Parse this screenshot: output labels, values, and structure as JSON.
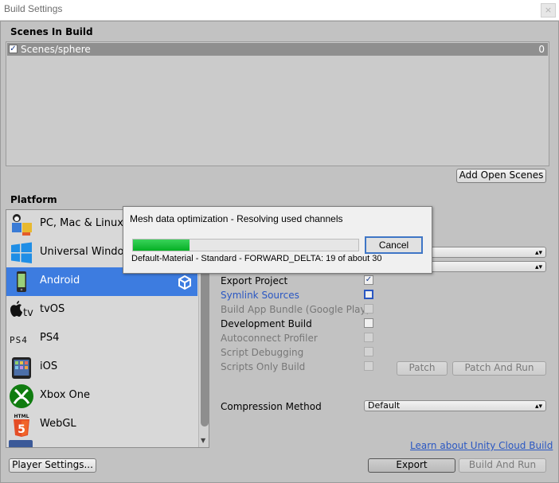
{
  "window": {
    "title": "Build Settings",
    "close_glyph": "×"
  },
  "scenes": {
    "header": "Scenes In Build",
    "items": [
      {
        "name": "Scenes/sphere",
        "index": "0",
        "checked": true
      }
    ],
    "add_open_scenes": "Add Open Scenes"
  },
  "platform": {
    "header": "Platform",
    "items": [
      {
        "label": "PC, Mac & Linux Standalone",
        "icon": "pc-mac-linux-icon"
      },
      {
        "label": "Universal Windows Platform",
        "icon": "windows-icon"
      },
      {
        "label": "Android",
        "icon": "android-icon",
        "selected": true
      },
      {
        "label": "tvOS",
        "icon": "tvos-icon"
      },
      {
        "label": "PS4",
        "icon": "ps4-icon"
      },
      {
        "label": "iOS",
        "icon": "ios-icon"
      },
      {
        "label": "Xbox One",
        "icon": "xbox-icon"
      },
      {
        "label": "WebGL",
        "icon": "webgl-icon"
      }
    ],
    "tvos_icon_text": "tv",
    "ps4_icon_text": "PS4",
    "html_icon_text": "HTML",
    "html_badge": "5"
  },
  "options": {
    "export_project": "Export Project",
    "symlink_sources": "Symlink Sources",
    "build_app_bundle": "Build App Bundle (Google Play)",
    "development_build": "Development Build",
    "autoconnect_profiler": "Autoconnect Profiler",
    "script_debugging": "Script Debugging",
    "scripts_only_build": "Scripts Only Build",
    "patch": "Patch",
    "patch_and_run": "Patch And Run",
    "compression_method": "Compression Method",
    "compression_value": "Default"
  },
  "footer": {
    "cloud_link": "Learn about Unity Cloud Build",
    "player_settings": "Player Settings...",
    "export": "Export",
    "build_and_run": "Build And Run"
  },
  "progress_dialog": {
    "title": "Mesh data optimization - Resolving used channels",
    "status": "Default-Material - Standard - FORWARD_DELTA: 19 of about 30",
    "cancel": "Cancel",
    "progress_fraction": 0.25
  },
  "colors": {
    "accent": "#3d7ce0",
    "link": "#2a57c2",
    "progress": "#06b025"
  }
}
